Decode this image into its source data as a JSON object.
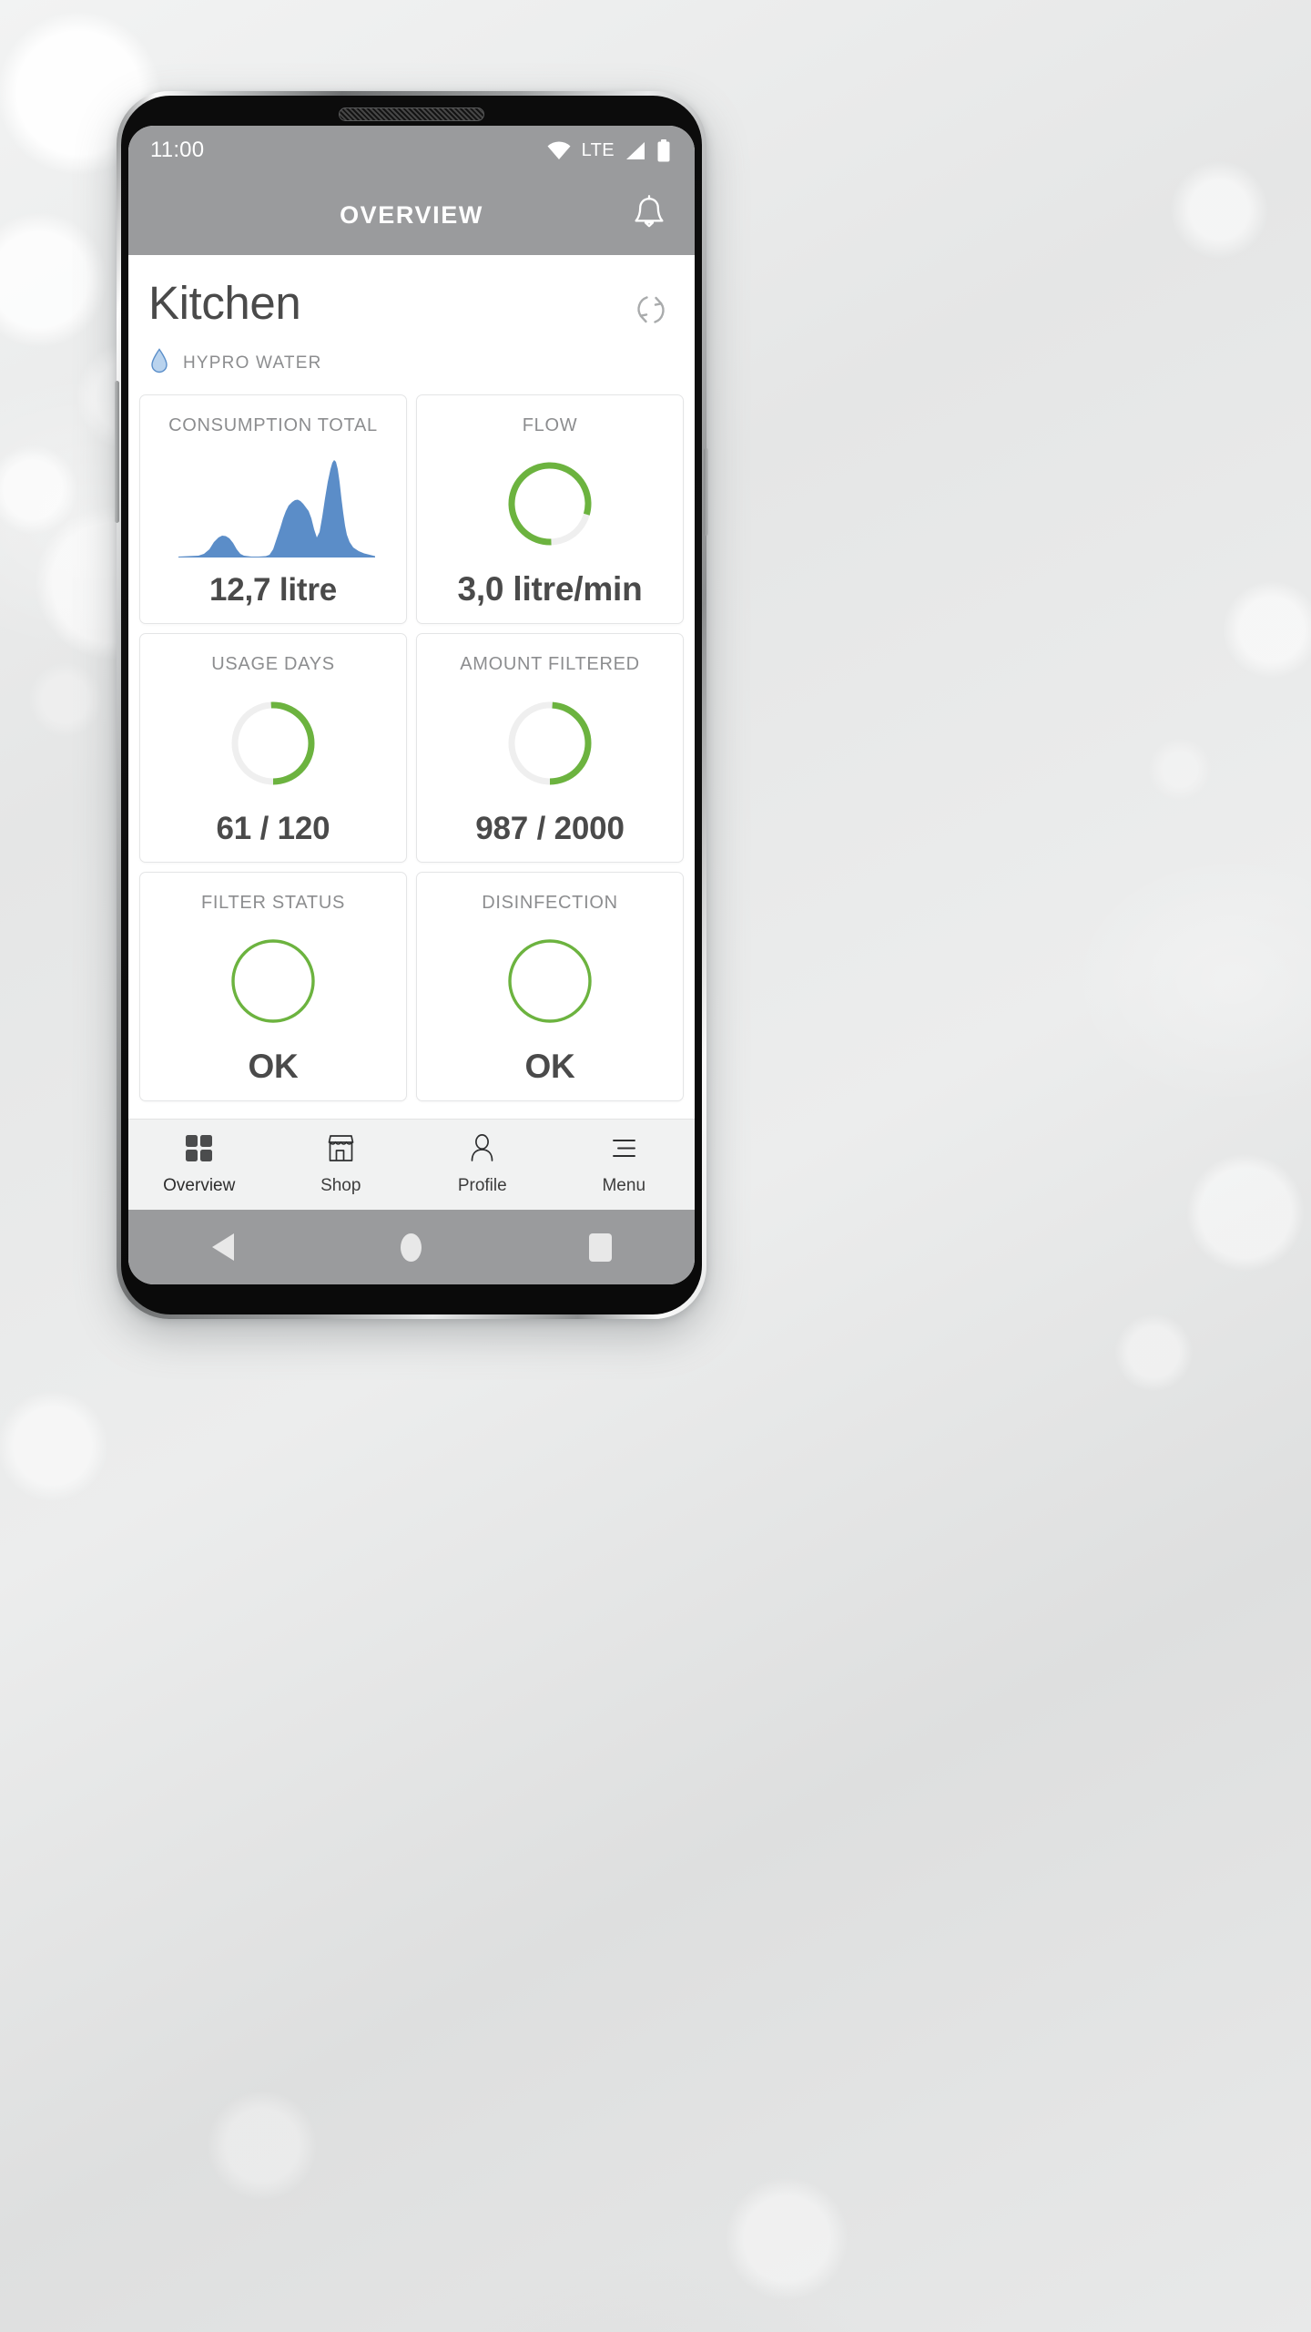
{
  "status_bar": {
    "time": "11:00",
    "network_label": "LTE",
    "icons": [
      "wifi-icon",
      "signal-icon",
      "battery-icon"
    ]
  },
  "app_bar": {
    "title": "OVERVIEW",
    "notification_icon": "bell-icon"
  },
  "page": {
    "title": "Kitchen",
    "refresh_icon": "refresh-icon",
    "brand_icon": "water-drop-icon",
    "brand_label": "HYPRO WATER"
  },
  "cards": [
    {
      "title": "CONSUMPTION TOTAL",
      "value": "12,7 litre",
      "visual": "area-chart"
    },
    {
      "title": "FLOW",
      "value": "3,0 litre/min",
      "visual": "ring",
      "ring_percent": 80
    },
    {
      "title": "USAGE DAYS",
      "value": "61 / 120",
      "visual": "ring",
      "ring_percent": 51
    },
    {
      "title": "AMOUNT FILTERED",
      "value": "987 / 2000",
      "visual": "ring",
      "ring_percent": 49
    },
    {
      "title": "FILTER STATUS",
      "value": "OK",
      "visual": "ring-full",
      "ring_percent": 100
    },
    {
      "title": "DISINFECTION",
      "value": "OK",
      "visual": "ring-full",
      "ring_percent": 100
    }
  ],
  "bottom_nav": [
    {
      "label": "Overview",
      "icon": "grid-icon",
      "active": true
    },
    {
      "label": "Shop",
      "icon": "store-icon",
      "active": false
    },
    {
      "label": "Profile",
      "icon": "person-icon",
      "active": false
    },
    {
      "label": "Menu",
      "icon": "hamburger-icon",
      "active": false
    }
  ],
  "system_nav": [
    {
      "icon": "back-triangle-icon"
    },
    {
      "icon": "home-circle-icon"
    },
    {
      "icon": "recents-square-icon"
    }
  ],
  "colors": {
    "accent_green": "#6CB33F",
    "chart_blue": "#5B8DC8",
    "ring_track": "#EFEFEF",
    "app_bar_grey": "#9A9B9D",
    "text_dark": "#4A4A4A",
    "text_muted": "#8C8D8F"
  },
  "chart_data": {
    "type": "area",
    "title": "CONSUMPTION TOTAL",
    "total_label": "12,7 litre",
    "xlabel": "",
    "ylabel": "",
    "grid": false,
    "legend": "none",
    "color": "#5B8DC8",
    "x": [
      0,
      4,
      8,
      12,
      15,
      17,
      19,
      21,
      23,
      25,
      27,
      30,
      34,
      38,
      42,
      46,
      50,
      52,
      54,
      56,
      58,
      60,
      62,
      64,
      66,
      68,
      70,
      72,
      74,
      76,
      78,
      80,
      82,
      84,
      86,
      88,
      90,
      92,
      94,
      96,
      100
    ],
    "values": [
      0,
      0,
      0,
      1,
      6,
      12,
      16,
      17,
      16,
      13,
      7,
      2,
      1,
      1,
      1,
      2,
      14,
      26,
      38,
      44,
      49,
      52,
      51,
      46,
      40,
      26,
      14,
      24,
      46,
      66,
      84,
      96,
      88,
      70,
      52,
      38,
      24,
      14,
      8,
      5,
      3
    ],
    "ylim": [
      0,
      100
    ]
  }
}
